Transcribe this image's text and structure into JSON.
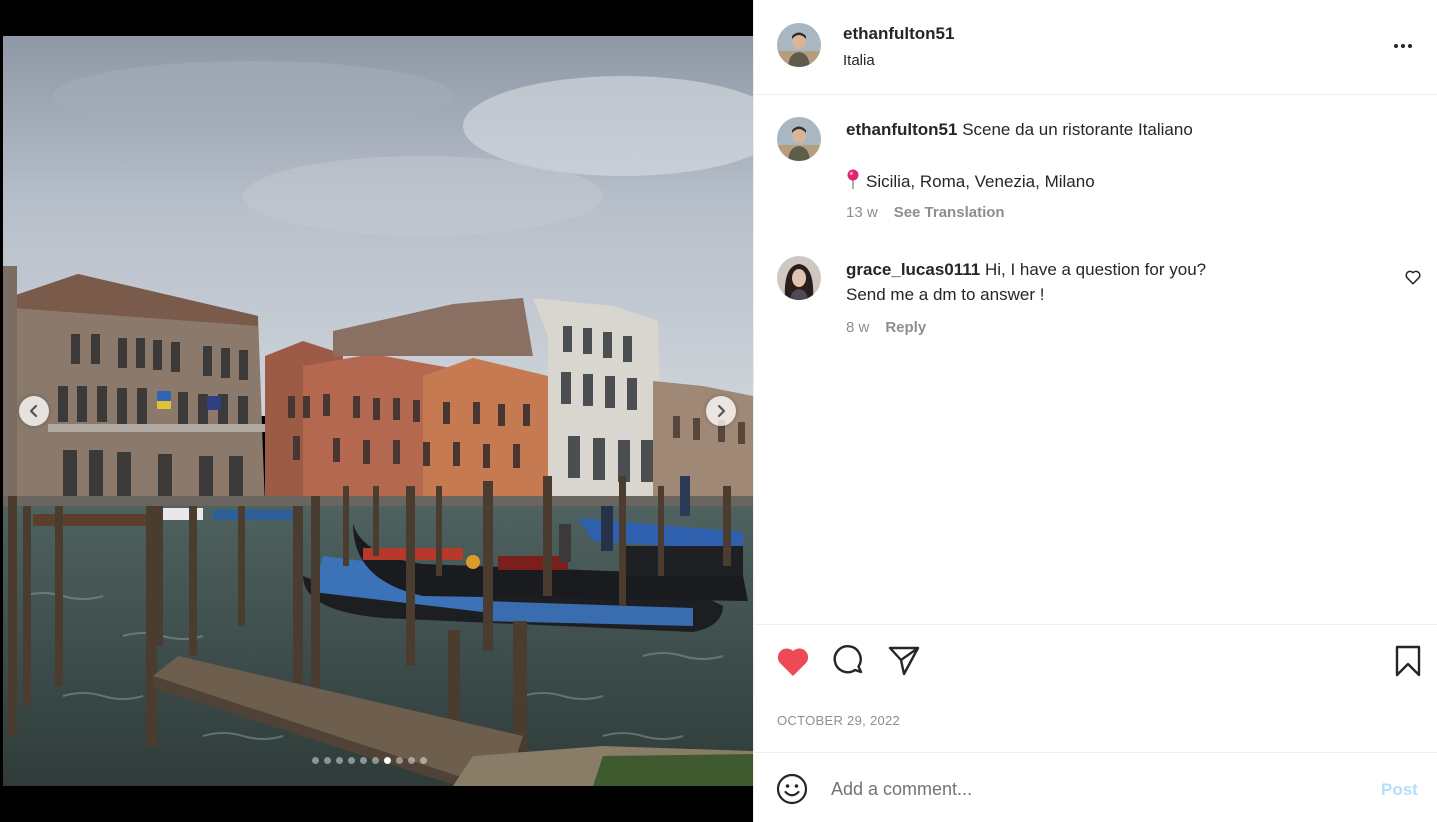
{
  "media": {
    "carousel": {
      "total_slides": 10,
      "active_slide": 7
    }
  },
  "header": {
    "username": "ethanfulton51",
    "location": "Italia"
  },
  "caption": {
    "username": "ethanfulton51",
    "text": "Scene da un ristorante Italiano",
    "places": "Sicilia, Roma, Venezia, Milano",
    "age": "13 w",
    "translate_label": "See Translation"
  },
  "comments": [
    {
      "username": "grace_lucas0111",
      "line1": "Hi, I have a question for you?",
      "line2": "Send me a dm to answer !",
      "age": "8 w",
      "reply_label": "Reply"
    }
  ],
  "actions": {
    "liked": true,
    "like_color": "#ed4956"
  },
  "post_date": "OCTOBER 29, 2022",
  "composer": {
    "placeholder": "Add a comment...",
    "post_label": "Post",
    "post_color": "#b2dffc"
  }
}
